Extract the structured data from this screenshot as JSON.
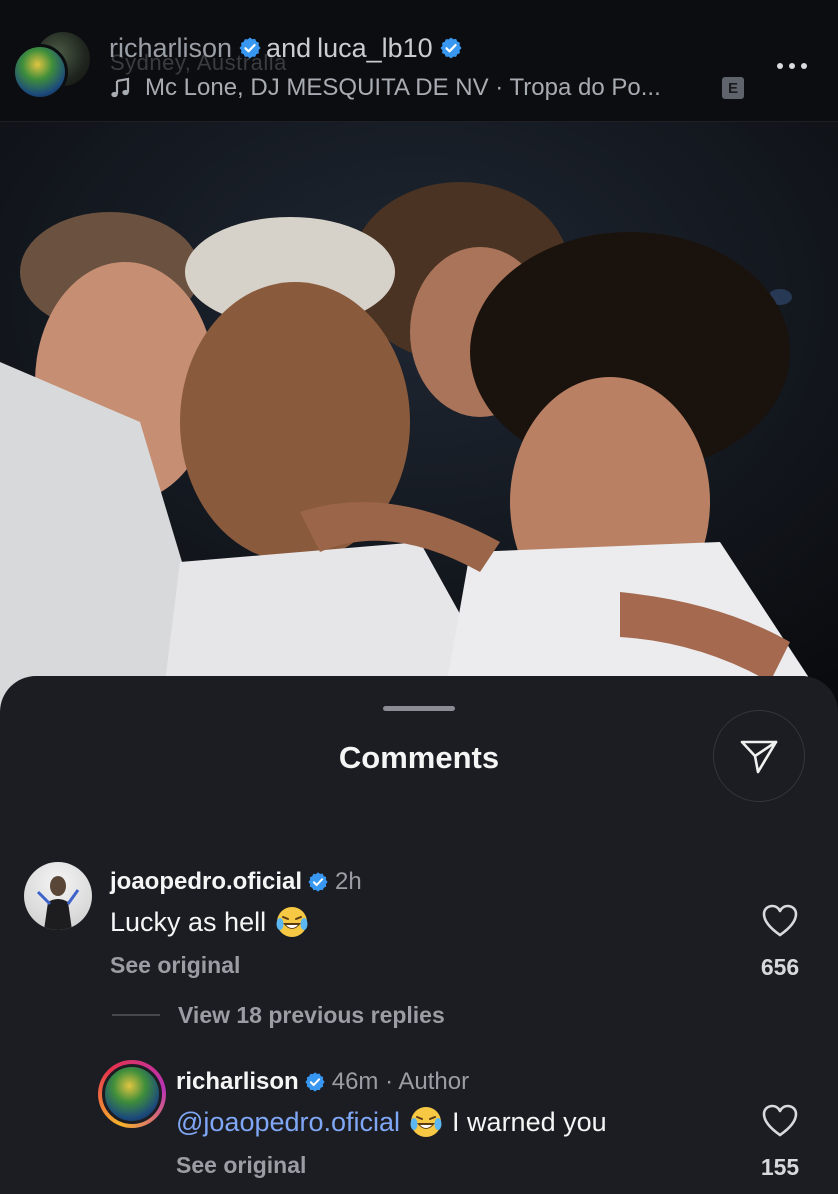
{
  "header": {
    "ghost_location": "Sydney, Australia",
    "user1": "richarlison",
    "and_text": "and",
    "user2": "luca_lb10",
    "music": "Mc Lone, DJ MESQUITA DE NV · Tropa do Po...",
    "explicit_badge": "E"
  },
  "sheet": {
    "title": "Comments"
  },
  "comments": [
    {
      "username": "joaopedro.oficial",
      "time": "2h",
      "text": "Lucky as hell",
      "emoji": "😂",
      "see_original": "See original",
      "likes": "656"
    },
    {
      "username": "richarlison",
      "time": "46m · Author",
      "mention": "@joaopedro.oficial",
      "emoji": "😂",
      "text": "I warned you",
      "see_original": "See original",
      "likes": "155"
    }
  ],
  "view_replies": "View 18 previous replies",
  "colors": {
    "verified": "#3897f0",
    "mention": "#7fa7f5",
    "sheet_bg": "#1c1d22"
  },
  "icons": [
    "music-note-icon",
    "verified-badge-icon",
    "more-options-icon",
    "share-send-icon",
    "heart-icon",
    "laughing-emoji-icon"
  ]
}
